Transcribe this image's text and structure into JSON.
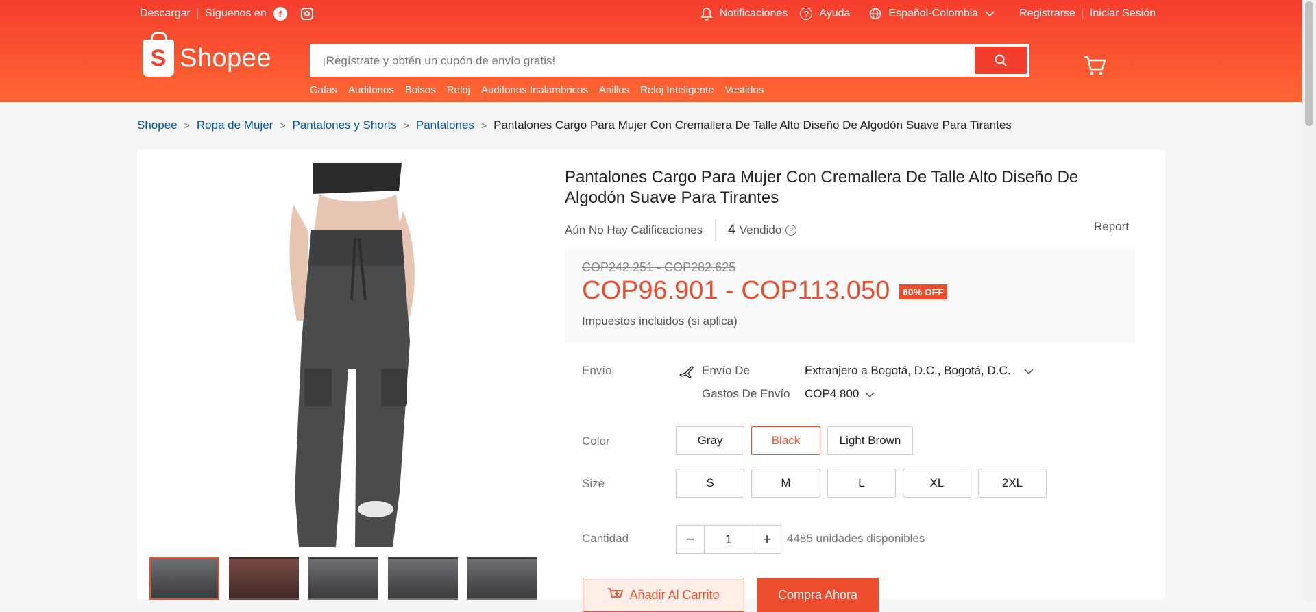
{
  "topbar": {
    "download": "Descargar",
    "follow": "Síguenos en",
    "notifications": "Notificaciones",
    "help": "Ayuda",
    "language": "Español-Colombia",
    "register": "Registrarse",
    "login": "Iniciar Sesión"
  },
  "brand": {
    "name": "Shopee"
  },
  "search": {
    "placeholder": "¡Regístrate y obtén un cupón de envío gratis!"
  },
  "categories": [
    "Gafas",
    "Audifonos",
    "Bolsos",
    "Reloj",
    "Audifonos Inalambricos",
    "Anillos",
    "Reloj Inteligente",
    "Vestidos"
  ],
  "breadcrumb": [
    "Shopee",
    "Ropa de Mujer",
    "Pantalones y Shorts",
    "Pantalones",
    "Pantalones Cargo Para Mujer Con Cremallera De Talle Alto Diseño De Algodón Suave Para Tirantes"
  ],
  "product": {
    "title": "Pantalones Cargo Para Mujer Con Cremallera De Talle Alto Diseño De Algodón Suave Para Tirantes",
    "ratings": "Aún No Hay Calificaciones",
    "sold_count": "4",
    "sold_label": "Vendido",
    "report": "Report",
    "old_price": "COP242.251 - COP282.625",
    "price": "COP96.901 - COP113.050",
    "discount": "60% OFF",
    "tax_note": "Impuestos incluidos (si aplica)"
  },
  "shipping": {
    "label": "Envío",
    "from_label": "Envío De",
    "from_value": "Extranjero a Bogotá, D.C., Bogotá, D.C.",
    "cost_label": "Gastos De Envío",
    "cost_value": "COP4.800"
  },
  "color": {
    "label": "Color",
    "options": [
      "Gray",
      "Black",
      "Light Brown"
    ],
    "selected": "Black"
  },
  "size": {
    "label": "Size",
    "options": [
      "S",
      "M",
      "L",
      "XL",
      "2XL"
    ]
  },
  "quantity": {
    "label": "Cantidad",
    "value": "1",
    "minus": "−",
    "plus": "+",
    "available": "4485 unidades disponibles"
  },
  "actions": {
    "add_to_cart": "Añadir Al Carrito",
    "buy_now": "Compra Ahora"
  },
  "colors": {
    "primary": "#ee4d2d",
    "header_top": "#f53d2d",
    "header_bottom": "#ff6633",
    "link": "#0055aa"
  }
}
